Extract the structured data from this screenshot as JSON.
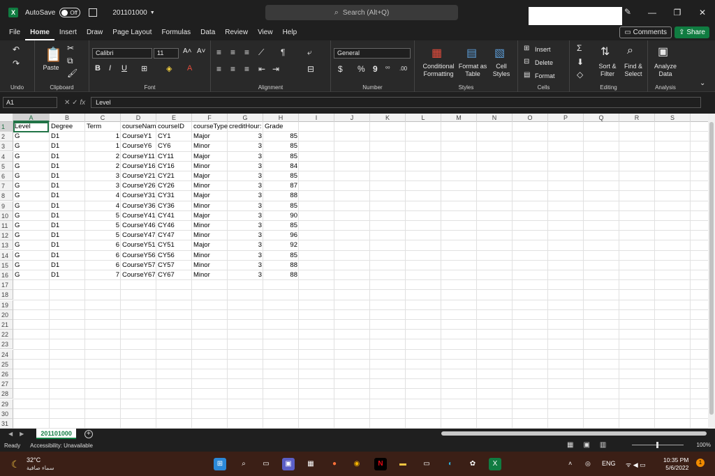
{
  "titlebar": {
    "autosave_label": "AutoSave",
    "autosave_state": "Off",
    "filename": "201101000",
    "search_placeholder": "Search (Alt+Q)"
  },
  "ribbon_tabs": [
    "File",
    "Home",
    "Insert",
    "Draw",
    "Page Layout",
    "Formulas",
    "Data",
    "Review",
    "View",
    "Help"
  ],
  "active_tab": "Home",
  "actions": {
    "comments": "Comments",
    "share": "Share"
  },
  "ribbon": {
    "undo_label": "Undo",
    "clipboard_label": "Clipboard",
    "paste_label": "Paste",
    "font_name": "Calibri",
    "font_size": "11",
    "font_label": "Font",
    "alignment_label": "Alignment",
    "number_format": "General",
    "number_label": "Number",
    "conditional_formatting": "Conditional Formatting",
    "format_as_table": "Format as Table",
    "cell_styles": "Cell Styles",
    "styles_label": "Styles",
    "insert": "Insert",
    "delete": "Delete",
    "format": "Format",
    "cells_label": "Cells",
    "sort_filter": "Sort & Filter",
    "find_select": "Find & Select",
    "editing_label": "Editing",
    "analyze_data": "Analyze Data",
    "analysis_label": "Analysis"
  },
  "formula_bar": {
    "name_box": "A1",
    "fx": "fx",
    "content": "Level"
  },
  "columns": [
    "A",
    "B",
    "C",
    "D",
    "E",
    "F",
    "G",
    "H",
    "I",
    "J",
    "K",
    "L",
    "M",
    "N",
    "O",
    "P",
    "Q",
    "R",
    "S"
  ],
  "row_numbers": [
    "1",
    "2",
    "3",
    "4",
    "5",
    "6",
    "7",
    "8",
    "9",
    "10",
    "11",
    "12",
    "13",
    "14",
    "15",
    "16",
    "17",
    "18",
    "19",
    "20",
    "21",
    "22",
    "23",
    "24",
    "25",
    "26",
    "27",
    "28",
    "29",
    "30",
    "31"
  ],
  "sheet_headers": [
    "Level",
    "Degree",
    "Term",
    "courseNam",
    "courseID",
    "courseType",
    "creditHour:",
    "Grade"
  ],
  "sheet_rows": [
    [
      "G",
      "D1",
      "",
      "1",
      "CourseY1",
      "CY1",
      "Major",
      "3",
      "85"
    ],
    [
      "G",
      "D1",
      "",
      "1",
      "CourseY6",
      "CY6",
      "Minor",
      "3",
      "85"
    ],
    [
      "G",
      "D1",
      "",
      "2",
      "CourseY11",
      "CY11",
      "Major",
      "3",
      "85"
    ],
    [
      "G",
      "D1",
      "",
      "2",
      "CourseY16",
      "CY16",
      "Minor",
      "3",
      "84"
    ],
    [
      "G",
      "D1",
      "",
      "3",
      "CourseY21",
      "CY21",
      "Major",
      "3",
      "85"
    ],
    [
      "G",
      "D1",
      "",
      "3",
      "CourseY26",
      "CY26",
      "Minor",
      "3",
      "87"
    ],
    [
      "G",
      "D1",
      "",
      "4",
      "CourseY31",
      "CY31",
      "Major",
      "3",
      "88"
    ],
    [
      "G",
      "D1",
      "",
      "4",
      "CourseY36",
      "CY36",
      "Minor",
      "3",
      "85"
    ],
    [
      "G",
      "D1",
      "",
      "5",
      "CourseY41",
      "CY41",
      "Major",
      "3",
      "90"
    ],
    [
      "G",
      "D1",
      "",
      "5",
      "CourseY46",
      "CY46",
      "Minor",
      "3",
      "85"
    ],
    [
      "G",
      "D1",
      "",
      "5",
      "CourseY47",
      "CY47",
      "Minor",
      "3",
      "96"
    ],
    [
      "G",
      "D1",
      "",
      "6",
      "CourseY51",
      "CY51",
      "Major",
      "3",
      "92"
    ],
    [
      "G",
      "D1",
      "",
      "6",
      "CourseY56",
      "CY56",
      "Minor",
      "3",
      "85"
    ],
    [
      "G",
      "D1",
      "",
      "6",
      "CourseY57",
      "CY57",
      "Minor",
      "3",
      "88"
    ],
    [
      "G",
      "D1",
      "",
      "7",
      "CourseY67",
      "CY67",
      "Minor",
      "3",
      "88"
    ]
  ],
  "sheet_tab": "201101000",
  "status": {
    "ready": "Ready",
    "accessibility": "Accessibility: Unavailable",
    "zoom": "100%"
  },
  "taskbar": {
    "temperature": "32°C",
    "weather_desc": "سماء صافية",
    "language": "ENG",
    "time": "10:35 PM",
    "date": "5/6/2022",
    "notification_count": "1"
  },
  "colors": {
    "excel_green": "#107c41",
    "selection_green": "#217346",
    "taskbar": "#3b1f16"
  }
}
